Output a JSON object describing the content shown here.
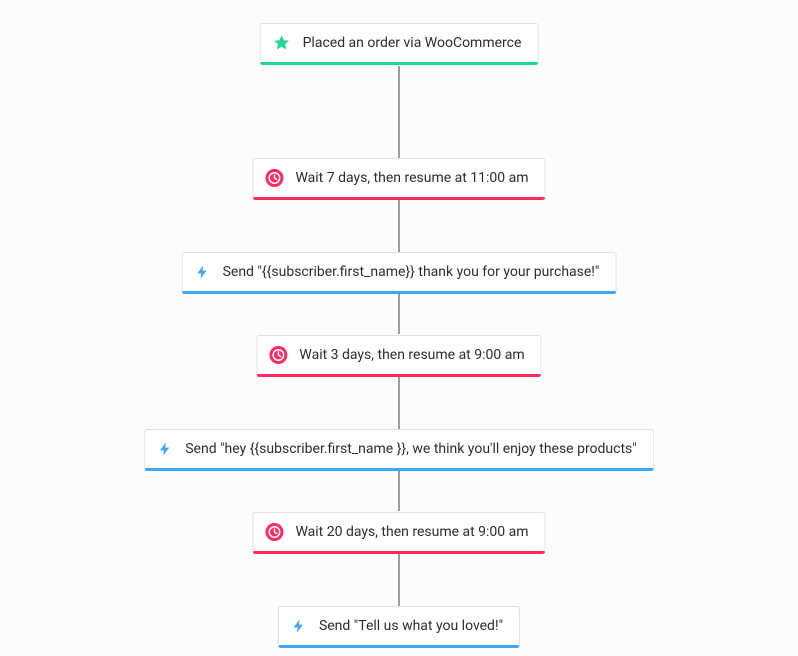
{
  "colors": {
    "trigger": "#1ed790",
    "wait": "#ff2b5e",
    "action": "#3ba9f4"
  },
  "steps": {
    "s1": {
      "kind": "trigger",
      "icon": "star-icon",
      "label": "Placed an order via WooCommerce"
    },
    "s2": {
      "kind": "wait",
      "icon": "clock-icon",
      "label": "Wait 7 days, then resume at 11:00 am"
    },
    "s3": {
      "kind": "action",
      "icon": "bolt-icon",
      "label": "Send \"{{subscriber.first_name}} thank you for your purchase!\""
    },
    "s4": {
      "kind": "wait",
      "icon": "clock-icon",
      "label": "Wait 3 days, then resume at 9:00 am"
    },
    "s5": {
      "kind": "action",
      "icon": "bolt-icon",
      "label": "Send \"hey {{subscriber.first_name }}, we think you'll enjoy these products\""
    },
    "s6": {
      "kind": "wait",
      "icon": "clock-icon",
      "label": "Wait 20 days, then resume at 9:00 am"
    },
    "s7": {
      "kind": "action",
      "icon": "bolt-icon",
      "label": "Send \"Tell us what you loved!\""
    }
  }
}
